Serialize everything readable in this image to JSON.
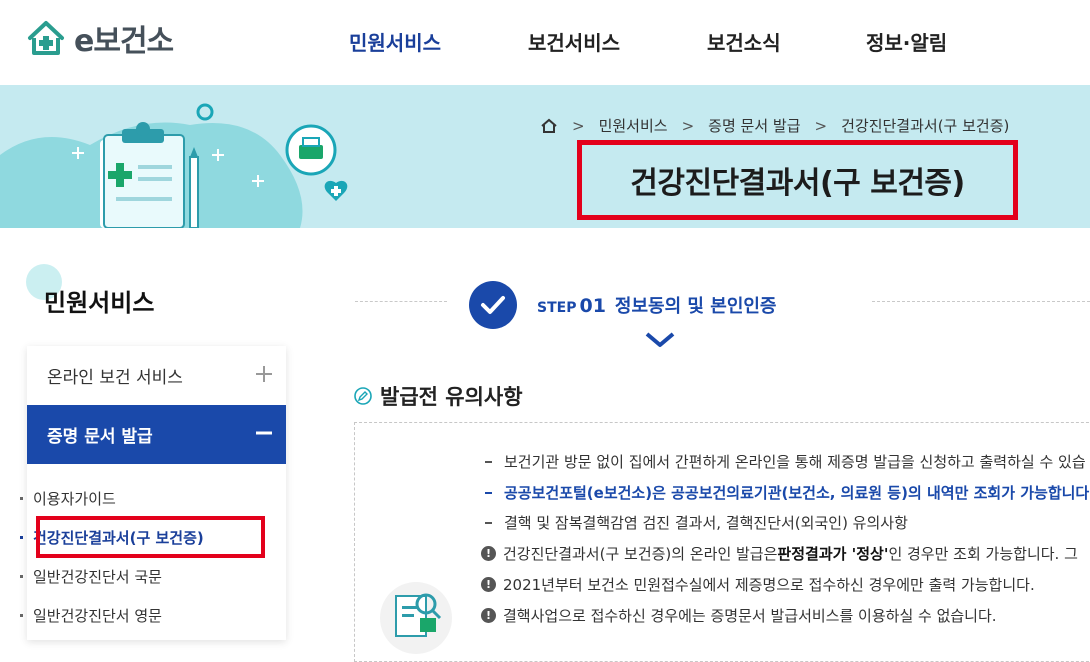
{
  "header": {
    "logo_text": "e보건소",
    "nav": [
      "민원서비스",
      "보건서비스",
      "보건소식",
      "정보·알림"
    ]
  },
  "banner": {
    "breadcrumb": [
      "민원서비스",
      "증명 문서 발급",
      "건강진단결과서(구 보건증)"
    ],
    "title": "건강진단결과서(구 보건증)"
  },
  "sidebar": {
    "title": "민원서비스",
    "menus": [
      {
        "label": "온라인 보건 서비스",
        "expanded": false
      },
      {
        "label": "증명 문서 발급",
        "expanded": true
      }
    ],
    "submenu": [
      "이용자가이드",
      "건강진단결과서(구 보건증)",
      "일반건강진단서 국문",
      "일반건강진단서 영문"
    ]
  },
  "step": {
    "word": "STEP",
    "number": "01",
    "text": "정보동의 및 본인인증"
  },
  "notice": {
    "title": "발급전 유의사항",
    "lines": [
      "보건기관 방문 없이 집에서 간편하게 온라인을 통해 제증명 발급을 신청하고 출력하실 수 있습",
      "공공보건포털(e보건소)은 공공보건의료기관(보건소, 의료원 등)의 내역만 조회가 가능합니다",
      "결핵 및 잠복결핵감염 검진 결과서, 결핵진단서(외국인) 유의사항"
    ],
    "warning_1_pre": "건강진단결과서(구 보건증)의 온라인 발급은 ",
    "warning_1_bold": "판정결과가 '정상'",
    "warning_1_post": "인 경우만 조회 가능합니다. 그",
    "warning_2": "2021년부터 보건소 민원접수실에서 제증명으로 접수하신 경우에만 출력 가능합니다.",
    "warning_3": "결핵사업으로 접수하신 경우에는 증명문서 발급서비스를 이용하실 수 없습니다."
  },
  "colors": {
    "brand_blue": "#1a49aa",
    "banner_bg": "#c5eaf0",
    "highlight_red": "#e3001b"
  }
}
